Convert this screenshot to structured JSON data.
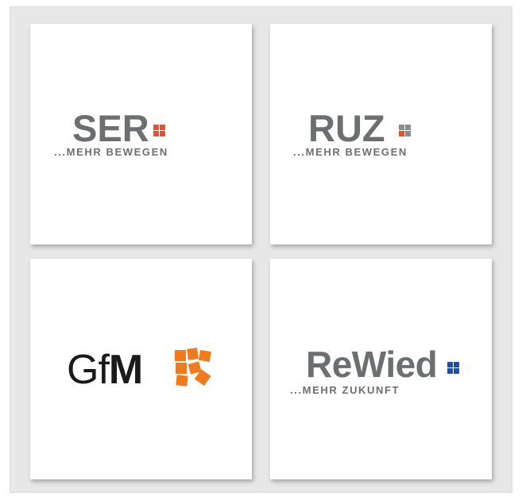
{
  "colors": {
    "frame": "#e7e7e7",
    "text_gray": "#6d6e70",
    "accent_orange": "#e8512a",
    "accent_gray": "#8a8b8d",
    "accent_blue": "#1f4fa8",
    "gfm_orange": "#f07a1f"
  },
  "logos": [
    {
      "name": "SER",
      "tagline": "...MEHR BEWEGEN",
      "square_color": "#e8512a"
    },
    {
      "name": "RUZ",
      "tagline": "...MEHR BEWEGEN",
      "square_color": "#8a8b8d"
    },
    {
      "name_light": "Gf",
      "name_bold": "M",
      "mark_color": "#f07a1f"
    },
    {
      "name": "ReWied",
      "tagline": "...MEHR ZUKUNFT",
      "square_color": "#1f4fa8"
    }
  ]
}
